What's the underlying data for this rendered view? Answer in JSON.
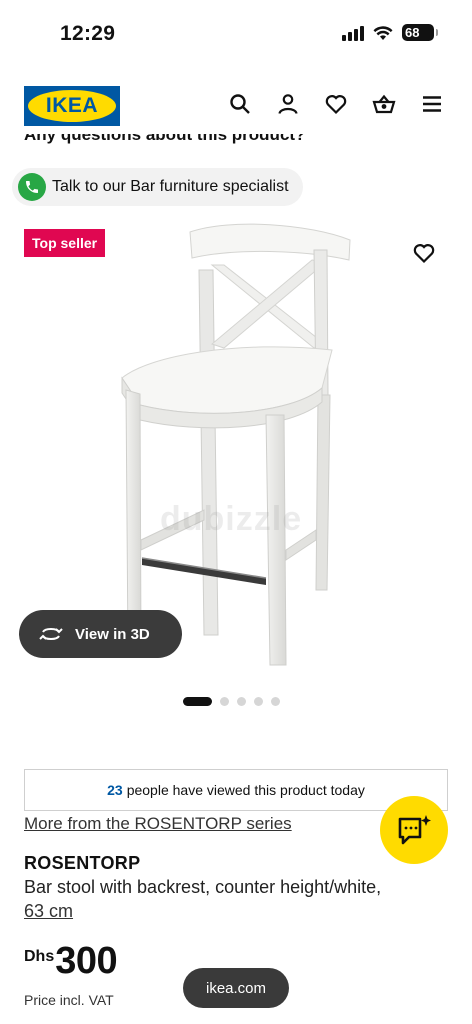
{
  "status_bar": {
    "time": "12:29",
    "battery": "68"
  },
  "header": {
    "logo": "IKEA",
    "icons": [
      "search-icon",
      "account-icon",
      "heart-icon",
      "basket-icon",
      "menu-icon"
    ]
  },
  "questions_heading": "Any questions about this product?",
  "specialist": {
    "label": "Talk to our Bar furniture specialist",
    "icon": "phone-icon",
    "icon_color": "#28a745"
  },
  "badge": {
    "label": "Top seller",
    "color": "#e00751"
  },
  "image": {
    "watermark": "dubizzle"
  },
  "view3d": {
    "label": "View in 3D"
  },
  "carousel": {
    "count": 5,
    "active": 1
  },
  "viewed": {
    "count": "23",
    "text": "people have viewed this product today"
  },
  "series_link": "More from the ROSENTORP series",
  "product": {
    "name": "ROSENTORP",
    "description": "Bar stool with backrest, counter height/white,",
    "size": "63 cm",
    "currency": "Dhs",
    "price": "300",
    "price_note": "Price incl. VAT"
  },
  "url_pill": "ikea.com",
  "colors": {
    "brand_blue": "#0058a3",
    "brand_yellow": "#ffdb00"
  }
}
